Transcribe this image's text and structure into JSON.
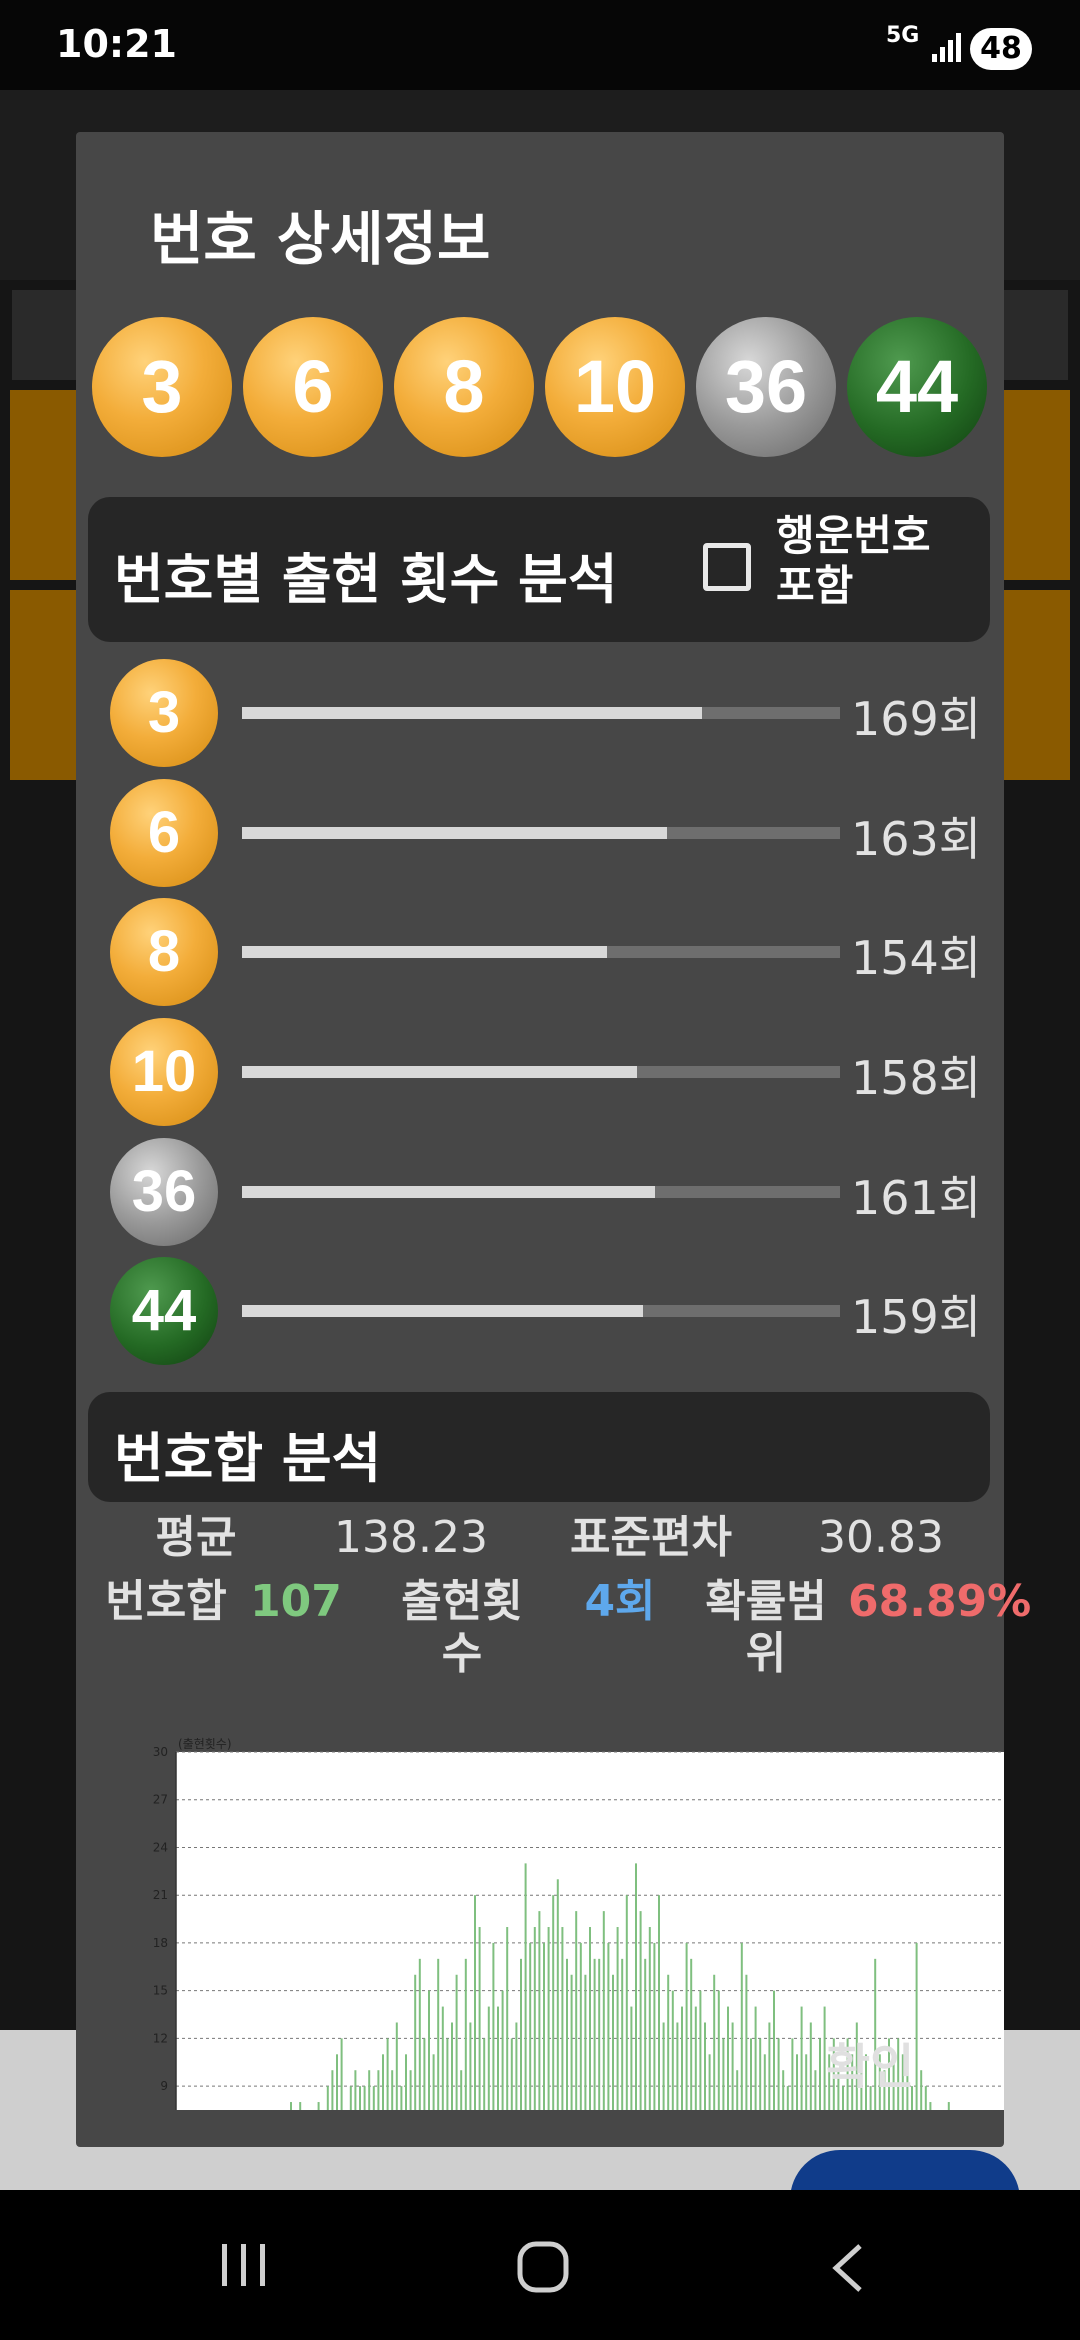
{
  "status": {
    "time": "10:21",
    "network": "5G",
    "battery": "48"
  },
  "dialog": {
    "title": "번호 상세정보",
    "numbers": [
      {
        "value": "3",
        "color": "orange"
      },
      {
        "value": "6",
        "color": "orange"
      },
      {
        "value": "8",
        "color": "orange"
      },
      {
        "value": "10",
        "color": "orange"
      },
      {
        "value": "36",
        "color": "gray"
      },
      {
        "value": "44",
        "color": "green"
      }
    ],
    "frequency_section": {
      "title": "번호별 출현 횟수 분석",
      "bonus_checkbox_label": "행운번호 포함",
      "bonus_checked": false,
      "rows": [
        {
          "number": "3",
          "color": "orange",
          "count_label": "169회",
          "fill": 0.77
        },
        {
          "number": "6",
          "color": "orange",
          "count_label": "163회",
          "fill": 0.71
        },
        {
          "number": "8",
          "color": "orange",
          "count_label": "154회",
          "fill": 0.61
        },
        {
          "number": "10",
          "color": "orange",
          "count_label": "158회",
          "fill": 0.66
        },
        {
          "number": "36",
          "color": "gray",
          "count_label": "161회",
          "fill": 0.69
        },
        {
          "number": "44",
          "color": "green",
          "count_label": "159회",
          "fill": 0.67
        }
      ]
    },
    "sum_section": {
      "title": "번호합 분석",
      "avg_label": "평균",
      "avg_value": "138.23",
      "std_label": "표준편차",
      "std_value": "30.83",
      "sum_label": "번호합",
      "sum_value": "107",
      "occ_label": "출현횟수",
      "occ_value": "4회",
      "prob_label": "확률범위",
      "prob_value": "68.89%"
    },
    "confirm_label": "확인"
  },
  "colors": {
    "sum_value": "#7fc97f",
    "occ_value": "#5ea8ec",
    "prob_value": "#ef6b6b",
    "orange": "#f0a736",
    "gray": "#9a9a9a",
    "green": "#246a24"
  },
  "chart_data": {
    "type": "bar",
    "ylabel": "(출현횟수)",
    "yticks": [
      9,
      12,
      15,
      18,
      21,
      24,
      27,
      30
    ],
    "ylim": [
      7.5,
      30
    ],
    "xlim": [
      40,
      220
    ],
    "grid": true,
    "x": [
      65,
      67,
      71,
      73,
      74,
      75,
      76,
      78,
      79,
      80,
      81,
      82,
      83,
      84,
      85,
      86,
      87,
      88,
      89,
      90,
      91,
      92,
      93,
      94,
      95,
      96,
      97,
      98,
      99,
      100,
      101,
      102,
      103,
      104,
      105,
      106,
      107,
      108,
      109,
      110,
      111,
      112,
      113,
      114,
      115,
      116,
      117,
      118,
      119,
      120,
      121,
      122,
      123,
      124,
      125,
      126,
      127,
      128,
      129,
      130,
      131,
      132,
      133,
      134,
      135,
      136,
      137,
      138,
      139,
      140,
      141,
      142,
      143,
      144,
      145,
      146,
      147,
      148,
      149,
      150,
      151,
      152,
      153,
      154,
      155,
      156,
      157,
      158,
      159,
      160,
      161,
      162,
      163,
      164,
      165,
      166,
      167,
      168,
      169,
      170,
      171,
      172,
      173,
      174,
      175,
      176,
      177,
      178,
      179,
      180,
      181,
      182,
      183,
      184,
      185,
      186,
      187,
      188,
      189,
      190,
      191,
      192,
      193,
      194,
      195,
      196,
      197,
      198,
      199,
      200,
      201,
      202,
      203,
      204,
      208
    ],
    "values": [
      8,
      8,
      8,
      9,
      10,
      11,
      12,
      9,
      10,
      9,
      9,
      10,
      9,
      10,
      11,
      12,
      10,
      13,
      9,
      11,
      10,
      16,
      17,
      12,
      15,
      11,
      17,
      14,
      12,
      13,
      16,
      10,
      17,
      13,
      21,
      19,
      12,
      14,
      18,
      14,
      15,
      19,
      12,
      13,
      17,
      23,
      18,
      19,
      20,
      18,
      19,
      21,
      22,
      19,
      17,
      16,
      20,
      18,
      16,
      19,
      17,
      17,
      20,
      18,
      16,
      19,
      17,
      21,
      14,
      23,
      20,
      17,
      19,
      18,
      21,
      13,
      16,
      15,
      13,
      14,
      18,
      17,
      14,
      15,
      13,
      11,
      16,
      15,
      12,
      14,
      13,
      10,
      18,
      16,
      12,
      14,
      12,
      11,
      13,
      15,
      12,
      10,
      9,
      12,
      11,
      14,
      11,
      13,
      10,
      12,
      14,
      11,
      12,
      10,
      9,
      12,
      11,
      13,
      10,
      11,
      9,
      17,
      11,
      10,
      12,
      11,
      12,
      11,
      11,
      9,
      18,
      10,
      9,
      8,
      8
    ]
  }
}
